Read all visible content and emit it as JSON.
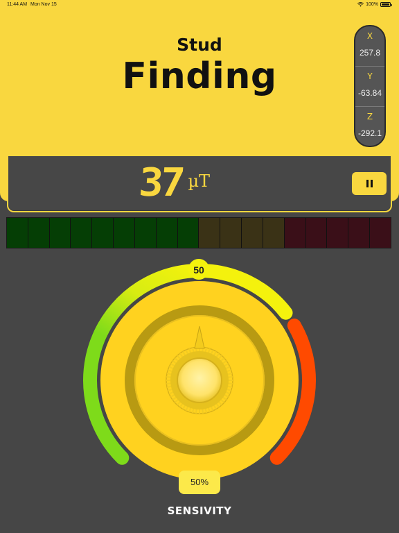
{
  "status_bar": {
    "time": "11:44 AM",
    "date": "Mon Nov 15",
    "battery": "100%",
    "battery_level": 1.0
  },
  "header": {
    "title_top": "Stud",
    "title_main": "Finding"
  },
  "axes": [
    {
      "label": "X",
      "value": "257.8"
    },
    {
      "label": "Y",
      "value": "-63.84"
    },
    {
      "label": "Z",
      "value": "-292.1"
    }
  ],
  "reading": {
    "value": "37",
    "unit": "µT"
  },
  "level_meter": {
    "segments": 18,
    "lit_count": 9,
    "colors": {
      "green": "#053E05",
      "olive": "#3A3216",
      "red": "#3A0F18"
    },
    "zones": [
      "green",
      "green",
      "green",
      "green",
      "green",
      "green",
      "green",
      "green",
      "green",
      "olive",
      "olive",
      "olive",
      "olive",
      "red",
      "red",
      "red",
      "red",
      "red"
    ]
  },
  "dial": {
    "knob_value": "50",
    "sensitivity_percent": "50%",
    "sensitivity_fraction": 0.5,
    "label": "SENSIVITY",
    "colors": {
      "body": "#FFD21F",
      "ring_dark": "#B89A12",
      "low": "#7EDB1A",
      "high": "#FF4A00",
      "mid": "#F4F20D"
    }
  }
}
